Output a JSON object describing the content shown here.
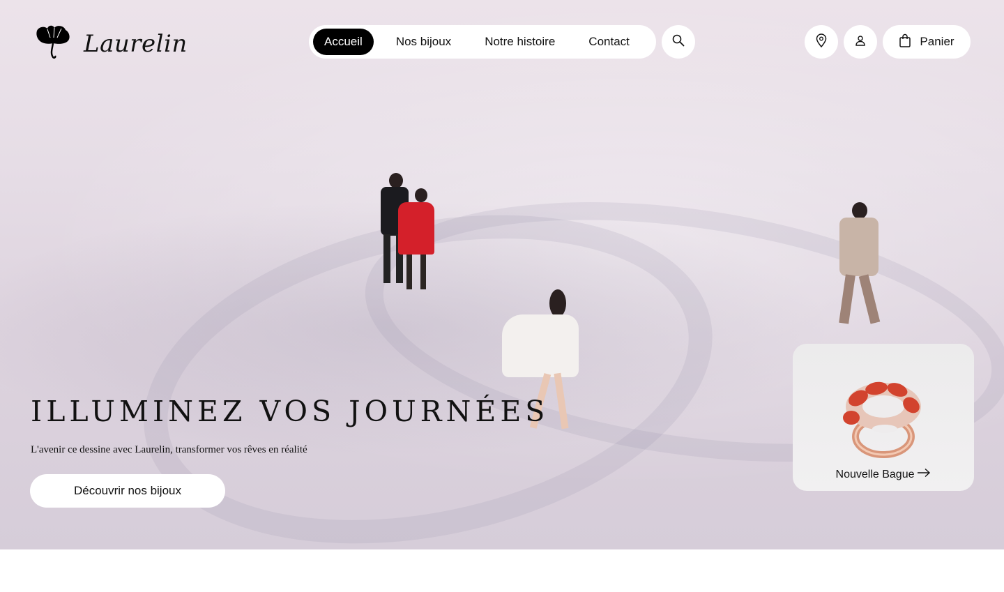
{
  "brand": {
    "name": "Laurelin",
    "logo_icon": "ginkgo-leaf-icon"
  },
  "nav": {
    "items": [
      {
        "label": "Accueil",
        "active": true
      },
      {
        "label": "Nos bijoux",
        "active": false
      },
      {
        "label": "Notre histoire",
        "active": false
      },
      {
        "label": "Contact",
        "active": false
      }
    ]
  },
  "actions": {
    "search_icon": "search-icon",
    "location_icon": "location-pin-icon",
    "account_icon": "user-icon",
    "cart_icon": "shopping-bag-icon",
    "cart_label": "Panier"
  },
  "hero": {
    "title": "ILLUMINEZ VOS JOURNÉES",
    "subtitle": "L'avenir ce dessine avec Laurelin, transformer vos rêves en réalité",
    "cta_label": "Découvrir nos bijoux"
  },
  "promo_card": {
    "label": "Nouvelle Bague",
    "arrow_icon": "arrow-right-icon",
    "image": "coral-diamond-ring"
  },
  "colors": {
    "accent": "#000000",
    "surface": "#ffffff",
    "background": "#e6dde6",
    "coral": "#d2432e",
    "rose_gold": "#d9967a"
  }
}
